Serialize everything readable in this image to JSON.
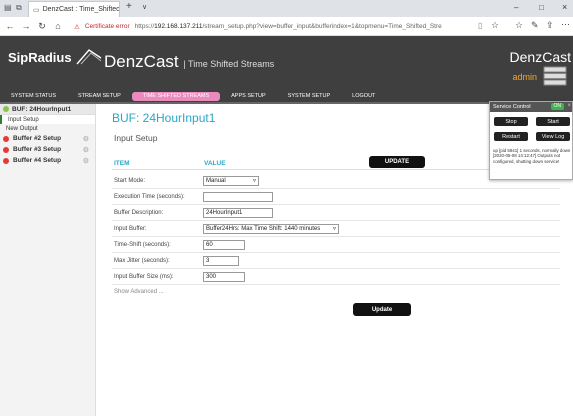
{
  "browser": {
    "tab_title": "DenzCast : Time_Shiftec",
    "tab_close": "×",
    "new_tab": "+",
    "tab_menu": "∨",
    "window_controls": [
      "–",
      "□",
      "×"
    ],
    "nav": [
      "←",
      "→",
      "↻",
      "⌂"
    ],
    "cert_error": "Certificate error",
    "url_prefix": "https://",
    "url_host": "192.168.137.211",
    "url_path": "/stream_setup.php?view=buffer_input&bufferindex=1&topmenu=Time_Shifted_Stre"
  },
  "app": {
    "logo": "SipRadius",
    "title": "DenzCast",
    "subtitle": "| Time Shifted Streams",
    "brand": "DenzCast",
    "user": "admin",
    "menu": [
      "SYSTEM STATUS",
      "STREAM SETUP",
      "TIME SHIFTED STREAMS",
      "APPS SETUP",
      "SYSTEM SETUP",
      "LOGOUT"
    ],
    "active_menu": "TIME SHIFTED STREAMS"
  },
  "sidebar": {
    "items": [
      {
        "label": "BUF: 24HourInput1",
        "status_color": "#8bc34a"
      },
      {
        "label": "Buffer #2 Setup",
        "status_color": "#e53935"
      },
      {
        "label": "Buffer #3 Setup",
        "status_color": "#e53935"
      },
      {
        "label": "Buffer #4 Setup",
        "status_color": "#e53935"
      }
    ],
    "subitems": [
      "Input Setup",
      "New Output"
    ]
  },
  "main": {
    "page_title": "BUF: 24HourInput1",
    "section_title": "Input Setup",
    "col_item": "ITEM",
    "col_value": "VALUE",
    "update_label": "UPDATE",
    "update_bottom_label": "Update",
    "show_advanced": "Show Advanced ...",
    "rows": [
      {
        "label": "Start Mode:",
        "value": "Manual"
      },
      {
        "label": "Execution Time (seconds):",
        "value": ""
      },
      {
        "label": "Buffer Description:",
        "value": "24HourInput1"
      },
      {
        "label": "Input Buffer:",
        "value": "Buffer24Hrs: Max Time Shift: 1440 minutes"
      },
      {
        "label": "Time-Shift (seconds):",
        "value": "60"
      },
      {
        "label": "Max Jitter (seconds):",
        "value": "3"
      },
      {
        "label": "Input Buffer Size (ms):",
        "value": "300"
      }
    ]
  },
  "service": {
    "title": "Service Control",
    "status": "ON",
    "stop": "Stop",
    "start": "Start",
    "restart": "Restart",
    "view_log": "View Log",
    "log": "up [pid 5841] 1 seconds, normally down [2020-05-08 14:12:47] Outputs not configured, shutting down service!"
  }
}
